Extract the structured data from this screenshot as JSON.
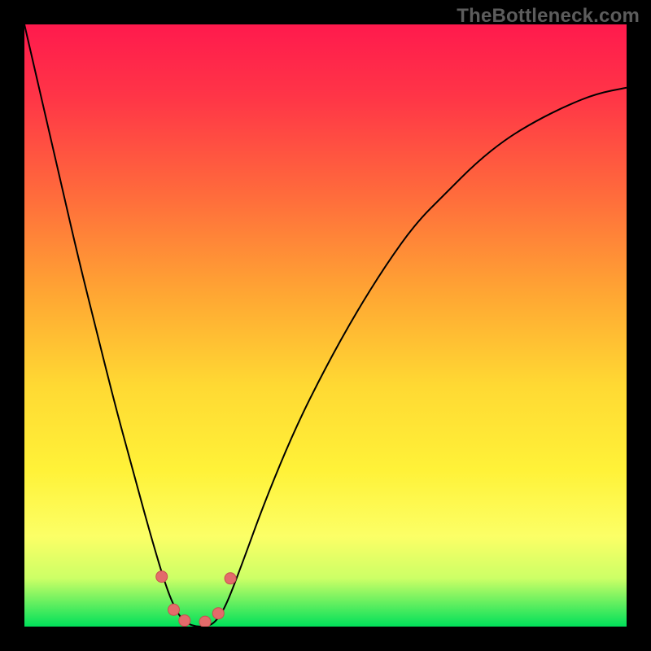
{
  "watermark": "TheBottleneck.com",
  "gradient": {
    "stops": [
      {
        "offset": 0.0,
        "color": "#ff1a4d"
      },
      {
        "offset": 0.12,
        "color": "#ff3547"
      },
      {
        "offset": 0.28,
        "color": "#ff6a3c"
      },
      {
        "offset": 0.45,
        "color": "#ffa733"
      },
      {
        "offset": 0.6,
        "color": "#ffd933"
      },
      {
        "offset": 0.74,
        "color": "#fff238"
      },
      {
        "offset": 0.85,
        "color": "#fcff66"
      },
      {
        "offset": 0.92,
        "color": "#ccff66"
      },
      {
        "offset": 1.0,
        "color": "#00e05a"
      }
    ]
  },
  "curve": {
    "stroke": "#000000",
    "width": 2
  },
  "markers": {
    "fill": "#e36b6b",
    "stroke": "#c94f4f",
    "radius": 7,
    "points": [
      {
        "x": 0.228,
        "y": 0.917
      },
      {
        "x": 0.248,
        "y": 0.972
      },
      {
        "x": 0.266,
        "y": 0.99
      },
      {
        "x": 0.3,
        "y": 0.992
      },
      {
        "x": 0.322,
        "y": 0.978
      },
      {
        "x": 0.342,
        "y": 0.92
      }
    ]
  },
  "chart_data": {
    "type": "line",
    "title": "",
    "xlabel": "",
    "ylabel": "",
    "xlim": [
      0,
      1
    ],
    "ylim": [
      0,
      1
    ],
    "series": [
      {
        "name": "bottleneck-curve",
        "x": [
          0.0,
          0.03,
          0.06,
          0.09,
          0.12,
          0.15,
          0.18,
          0.21,
          0.237,
          0.255,
          0.27,
          0.285,
          0.3,
          0.315,
          0.333,
          0.36,
          0.4,
          0.45,
          0.5,
          0.55,
          0.6,
          0.65,
          0.7,
          0.75,
          0.8,
          0.85,
          0.9,
          0.95,
          1.0
        ],
        "y": [
          1.0,
          0.87,
          0.74,
          0.61,
          0.49,
          0.37,
          0.26,
          0.15,
          0.06,
          0.02,
          0.005,
          0.0,
          0.0,
          0.005,
          0.03,
          0.1,
          0.21,
          0.33,
          0.43,
          0.52,
          0.6,
          0.67,
          0.72,
          0.77,
          0.81,
          0.84,
          0.865,
          0.885,
          0.895
        ]
      }
    ],
    "annotations": [
      {
        "text": "TheBottleneck.com",
        "position": "top-right"
      }
    ]
  }
}
